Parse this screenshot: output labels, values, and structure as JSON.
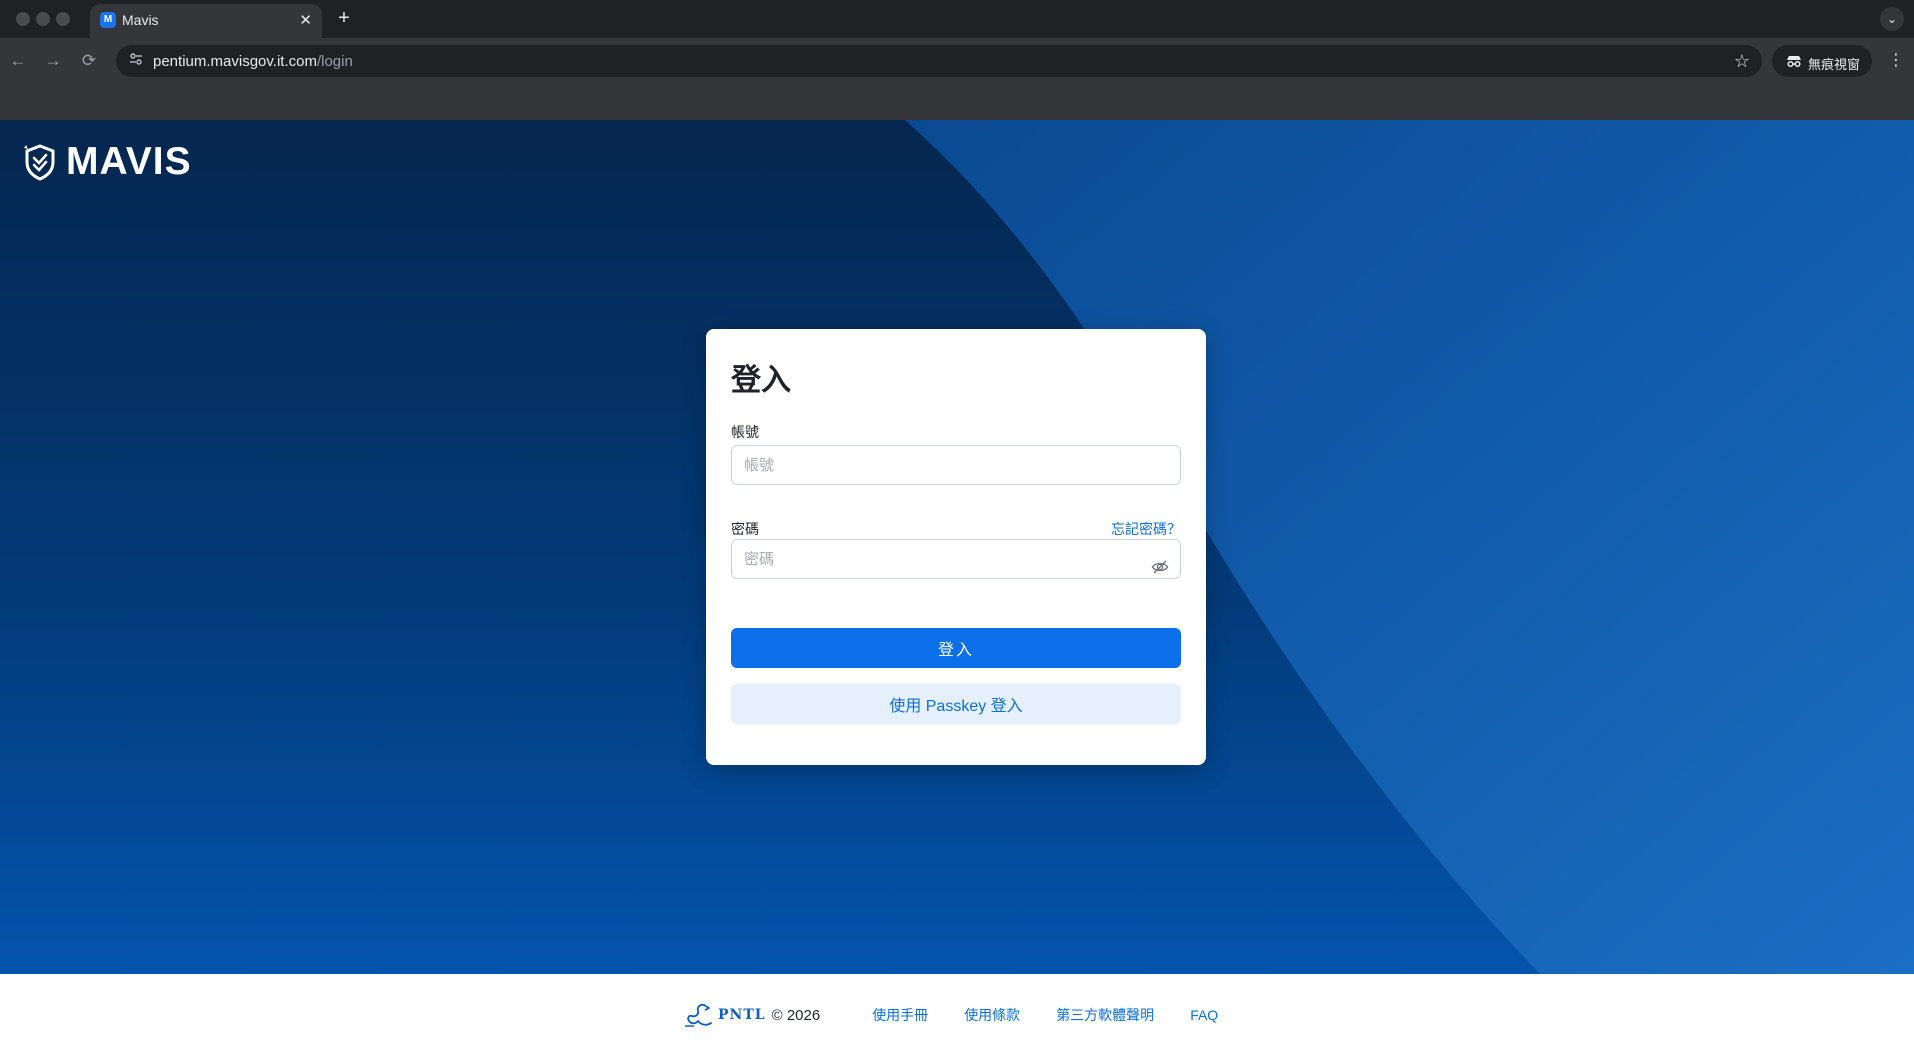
{
  "browser": {
    "tab_title": "Mavis",
    "tab_close": "✕",
    "new_tab": "+",
    "url_host": "pentium.mavisgov.it.com",
    "url_path": "/login",
    "incognito_label": "無痕視窗"
  },
  "brand": {
    "name": "MAVIS"
  },
  "login": {
    "title": "登入",
    "account_label": "帳號",
    "account_placeholder": "帳號",
    "account_value": "",
    "password_label": "密碼",
    "password_placeholder": "密碼",
    "password_value": "",
    "forgot_password": "忘記密碼？",
    "submit_label": "登入",
    "passkey_label": "使用 Passkey 登入"
  },
  "footer": {
    "company": "PNTL",
    "copyright": "© 2026",
    "links": [
      "使用手冊",
      "使用條款",
      "第三方軟體聲明",
      "FAQ"
    ]
  },
  "colors": {
    "accent": "#0a6fe8",
    "secondary_button_bg": "#e6f0fc",
    "page_bg_dark": "#05264f",
    "page_bg_light": "#0454ad"
  },
  "icons": {
    "back": "arrow-left-icon",
    "forward": "arrow-right-icon",
    "reload": "reload-icon",
    "site_info": "tune-icon",
    "bookmark": "star-icon",
    "incognito": "incognito-icon",
    "menu": "kebab-menu-icon",
    "password_visibility": "eye-off-icon"
  }
}
